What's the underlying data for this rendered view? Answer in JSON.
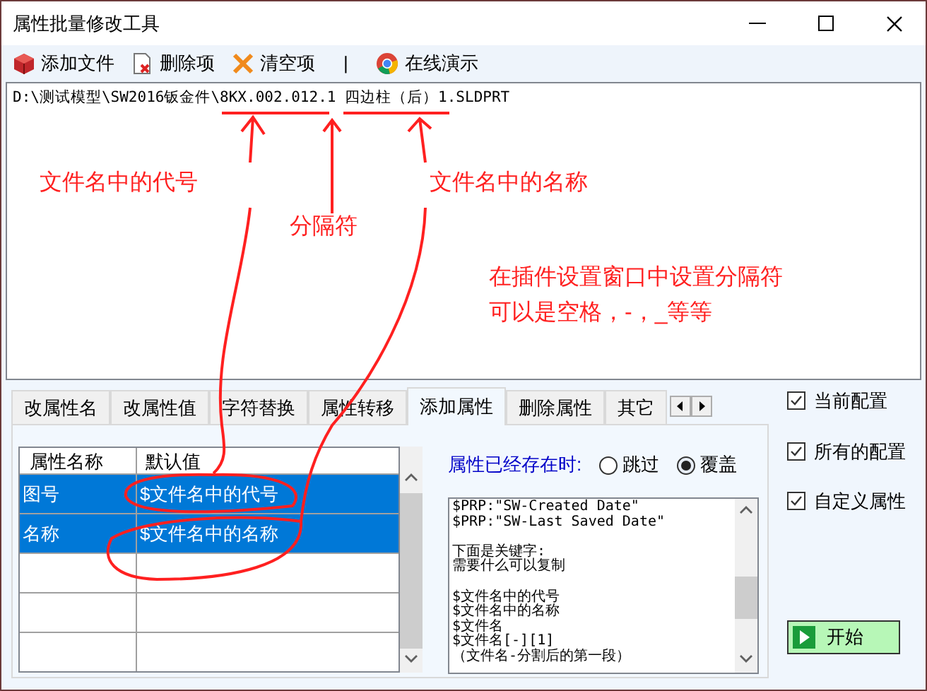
{
  "window": {
    "title": "属性批量修改工具"
  },
  "toolbar": [
    {
      "kind": "button",
      "label": "添加文件"
    },
    {
      "kind": "button",
      "label": "删除项"
    },
    {
      "kind": "button",
      "label": "清空项"
    },
    {
      "kind": "separator",
      "label": "|"
    },
    {
      "kind": "button",
      "label": "在线演示"
    }
  ],
  "file_list": [
    "D:\\测试模型\\SW2016钣金件\\8KX.002.012.1 四边柱（后）1.SLDPRT"
  ],
  "annotations": [
    "文件名中的代号",
    "分隔符",
    "文件名中的名称",
    "在插件设置窗口中设置分隔符",
    "可以是空格，-，_等等"
  ],
  "tabs": [
    {
      "label": "改属性名",
      "selected": false
    },
    {
      "label": "改属性值",
      "selected": false
    },
    {
      "label": "字符替换",
      "selected": false
    },
    {
      "label": "属性转移",
      "selected": false
    },
    {
      "label": "添加属性",
      "selected": true
    },
    {
      "label": "删除属性",
      "selected": false
    },
    {
      "label": "其它",
      "selected": false
    }
  ],
  "property_grid": {
    "columns": [
      "属性名称",
      "默认值"
    ],
    "rows": [
      {
        "cells": [
          "图号",
          "$文件名中的代号"
        ],
        "selected": true
      },
      {
        "cells": [
          "名称",
          "$文件名中的名称"
        ],
        "selected": true
      }
    ]
  },
  "existing_property": {
    "label": "属性已经存在时:",
    "options": [
      {
        "label": "跳过",
        "selected": false
      },
      {
        "label": "覆盖",
        "selected": true
      }
    ]
  },
  "keywords_text": [
    [
      "$PRP:\"SW-Created Date\"",
      "$PRP:\"SW-Last Saved Date\""
    ],
    [
      "下面是关键字:",
      "需要什么可以复制"
    ],
    [
      "$文件名中的代号",
      "$文件名中的名称",
      "$文件名",
      "$文件名[-][1]",
      "（文件名-分割后的第一段）"
    ]
  ],
  "checkboxes": [
    {
      "label": "当前配置",
      "checked": true
    },
    {
      "label": "所有的配置",
      "checked": true
    },
    {
      "label": "自定义属性",
      "checked": true
    }
  ],
  "start_button": {
    "label": "开始"
  }
}
